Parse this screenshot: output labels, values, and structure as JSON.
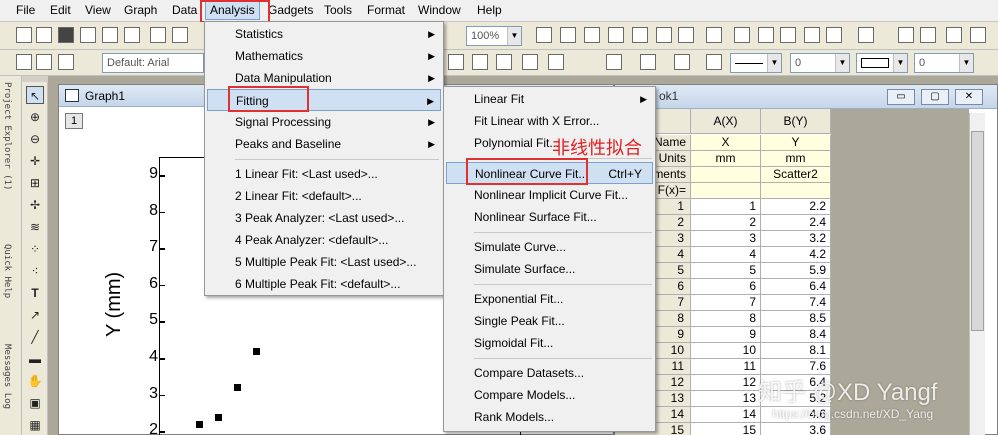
{
  "menubar": {
    "items": [
      "File",
      "Edit",
      "View",
      "Graph",
      "Data",
      "Analysis",
      "Gadgets",
      "Tools",
      "Format",
      "Window",
      "Help"
    ],
    "active": "Analysis"
  },
  "toolbar": {
    "zoom": "100%",
    "style": "Default: Arial",
    "combo_zero_1": "0",
    "combo_zero_2": "0"
  },
  "side_tabs": [
    "Project Explorer (1)",
    "Quick Help",
    "Messages Log"
  ],
  "graph": {
    "title": "Graph1",
    "layer": "1",
    "ylabel": "Y (mm)",
    "yticks": [
      "9",
      "8",
      "7",
      "6",
      "5",
      "4",
      "3",
      "2"
    ]
  },
  "chart_data": {
    "type": "scatter",
    "title": "",
    "ylabel": "Y (mm)",
    "xlabel": "",
    "ylim": [
      1.8,
      9.6
    ],
    "series": [
      {
        "name": "B(Y)",
        "x": [
          1,
          2,
          3,
          4,
          5,
          6,
          7,
          8,
          9,
          10,
          11,
          12,
          13,
          14,
          15
        ],
        "y": [
          2.2,
          2.4,
          3.2,
          4.2,
          5.9,
          6.4,
          7.4,
          8.5,
          8.4,
          8.1,
          7.6,
          6.4,
          5.2,
          4.6,
          3.6
        ]
      }
    ]
  },
  "worksheet": {
    "title_suffix": "ok1",
    "columns": [
      "A(X)",
      "B(Y)"
    ],
    "meta_labels": [
      "Long Name",
      "Units",
      "Comments",
      "F(x)="
    ],
    "meta_labels_visible": [
      "Name",
      "Units",
      "ments",
      "F(x)="
    ],
    "long_name": [
      "X",
      "Y"
    ],
    "units": [
      "mm",
      "mm"
    ],
    "comments": [
      "",
      "Scatter2"
    ],
    "rows": [
      [
        "1",
        "1",
        "2.2"
      ],
      [
        "2",
        "2",
        "2.4"
      ],
      [
        "3",
        "3",
        "3.2"
      ],
      [
        "4",
        "4",
        "4.2"
      ],
      [
        "5",
        "5",
        "5.9"
      ],
      [
        "6",
        "6",
        "6.4"
      ],
      [
        "7",
        "7",
        "7.4"
      ],
      [
        "8",
        "8",
        "8.5"
      ],
      [
        "9",
        "9",
        "8.4"
      ],
      [
        "10",
        "10",
        "8.1"
      ],
      [
        "11",
        "11",
        "7.6"
      ],
      [
        "12",
        "12",
        "6.4"
      ],
      [
        "13",
        "13",
        "5.2"
      ],
      [
        "14",
        "14",
        "4.6"
      ],
      [
        "15",
        "15",
        "3.6"
      ]
    ]
  },
  "analysis_menu": {
    "items": [
      "Statistics",
      "Mathematics",
      "Data Manipulation",
      "Fitting",
      "Signal Processing",
      "Peaks and Baseline"
    ],
    "recent": [
      "1 Linear Fit: <Last used>...",
      "2 Linear Fit: <default>...",
      "3 Peak Analyzer: <Last used>...",
      "4 Peak Analyzer: <default>...",
      "5 Multiple Peak Fit: <Last used>...",
      "6 Multiple Peak Fit: <default>..."
    ]
  },
  "fitting_menu": {
    "group1": [
      "Linear Fit",
      "Fit Linear with X Error...",
      "Polynomial Fit..."
    ],
    "group2": [
      "Nonlinear Curve Fit...",
      "Nonlinear Implicit Curve Fit...",
      "Nonlinear Surface Fit..."
    ],
    "nonlinear_shortcut": "Ctrl+Y",
    "group3": [
      "Simulate Curve...",
      "Simulate Surface..."
    ],
    "group4": [
      "Exponential Fit...",
      "Single Peak Fit...",
      "Sigmoidal Fit..."
    ],
    "group5": [
      "Compare Datasets...",
      "Compare Models...",
      "Rank Models..."
    ]
  },
  "annotation": "非线性拟合",
  "watermark": {
    "main": "知乎 @XD Yangf",
    "sub": "https://blog.csdn.net/XD_Yang"
  },
  "colors": {
    "highlight": "#cfe0f3",
    "annotation_red": "#e03030"
  }
}
